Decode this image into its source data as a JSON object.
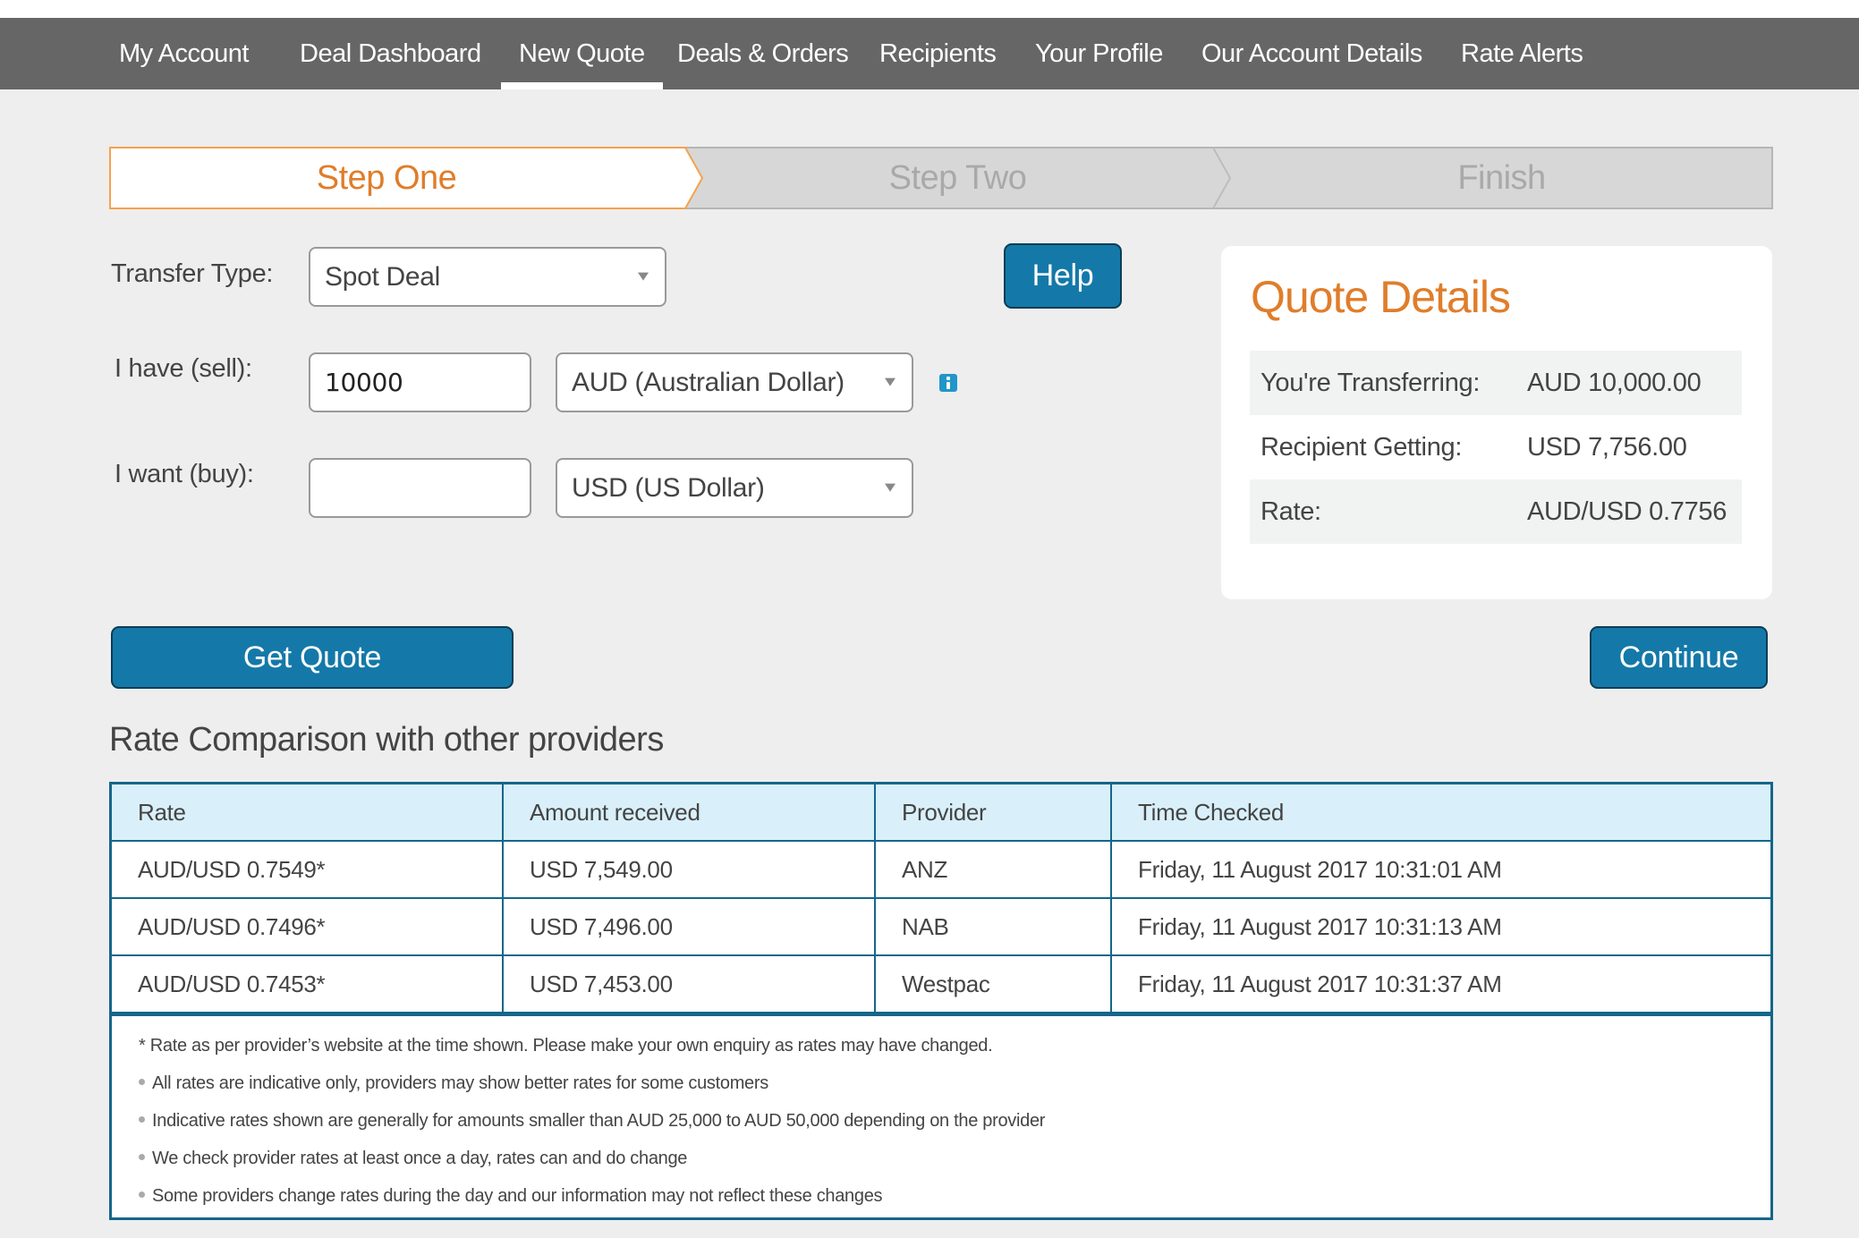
{
  "nav": {
    "items": [
      {
        "label": "My Account",
        "active": false
      },
      {
        "label": "Deal Dashboard",
        "active": false
      },
      {
        "label": "New Quote",
        "active": true
      },
      {
        "label": "Deals & Orders",
        "active": false
      },
      {
        "label": "Recipients",
        "active": false
      },
      {
        "label": "Your Profile",
        "active": false
      },
      {
        "label": "Our Account Details",
        "active": false
      },
      {
        "label": "Rate Alerts",
        "active": false
      }
    ]
  },
  "stepper": {
    "steps": [
      {
        "label": "Step One",
        "state": "active"
      },
      {
        "label": "Step Two",
        "state": "inactive"
      },
      {
        "label": "Finish",
        "state": "inactive"
      }
    ]
  },
  "form": {
    "transfer_type": {
      "label": "Transfer Type:",
      "value": "Spot Deal"
    },
    "sell": {
      "label": "I have (sell):",
      "amount": "10000",
      "currency": "AUD (Australian Dollar)"
    },
    "buy": {
      "label": "I want (buy):",
      "amount": "",
      "currency": "USD (US Dollar)"
    },
    "help_label": "Help",
    "get_quote_label": "Get Quote",
    "continue_label": "Continue"
  },
  "quote": {
    "title": "Quote Details",
    "rows": [
      {
        "key": "You're Transferring:",
        "value": "AUD 10,000.00"
      },
      {
        "key": "Recipient Getting:",
        "value": "USD 7,756.00"
      },
      {
        "key": "Rate:",
        "value": "AUD/USD 0.7756"
      }
    ]
  },
  "comparison": {
    "title": "Rate Comparison with other providers",
    "columns": [
      "Rate",
      "Amount received",
      "Provider",
      "Time Checked"
    ],
    "rows": [
      [
        "AUD/USD 0.7549*",
        "USD 7,549.00",
        "ANZ",
        "Friday, 11 August 2017 10:31:01 AM"
      ],
      [
        "AUD/USD 0.7496*",
        "USD 7,496.00",
        "NAB",
        "Friday, 11 August 2017 10:31:13 AM"
      ],
      [
        "AUD/USD 0.7453*",
        "USD 7,453.00",
        "Westpac",
        "Friday, 11 August 2017 10:31:37 AM"
      ]
    ],
    "footnote": "* Rate as per provider’s website at the time shown. Please make your own enquiry as rates may have changed.",
    "notes": [
      "All rates are indicative only, providers may show better rates for some customers",
      "Indicative rates shown are generally for amounts smaller than AUD 25,000 to AUD 50,000 depending on the provider",
      "We check provider rates at least once a day, rates can and do change",
      "Some providers change rates during the day and our information may not reflect these changes"
    ]
  },
  "colors": {
    "nav_bg": "#666666",
    "accent_orange": "#e07d2a",
    "button_blue": "#1479a8",
    "table_border": "#15668a",
    "table_header_bg": "#d9f0fa",
    "page_bg": "#eeeeee"
  }
}
